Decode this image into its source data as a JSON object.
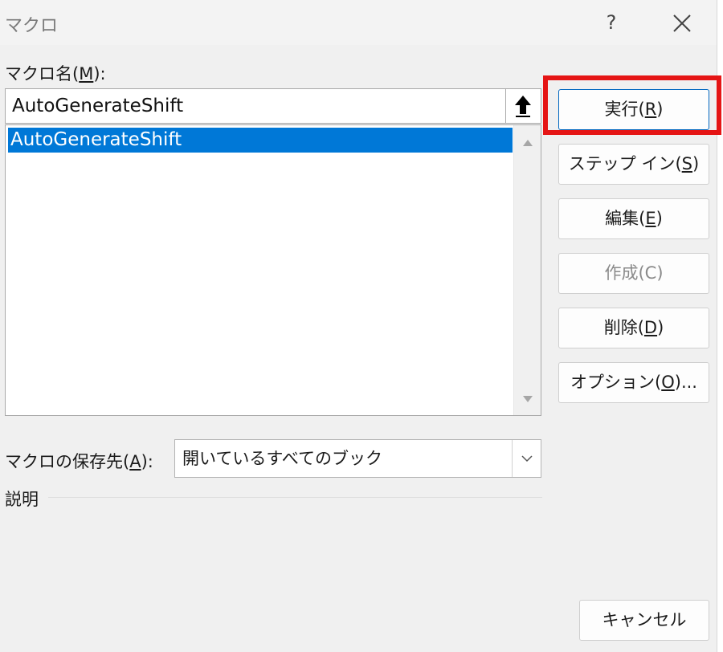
{
  "window": {
    "title": "マクロ",
    "help_label": "?",
    "close_icon": "close-icon"
  },
  "macro_name": {
    "label_prefix": "マクロ名(",
    "label_key": "M",
    "label_suffix": "):",
    "value": "AutoGenerateShift"
  },
  "macro_list": {
    "items": [
      "AutoGenerateShift"
    ],
    "selected_index": 0
  },
  "buttons": {
    "run": {
      "prefix": "実行(",
      "key": "R",
      "suffix": ")"
    },
    "step_in": {
      "prefix": "ステップ イン(",
      "key": "S",
      "suffix": ")"
    },
    "edit": {
      "prefix": "編集(",
      "key": "E",
      "suffix": ")"
    },
    "create": {
      "label": "作成(C)"
    },
    "delete": {
      "prefix": "削除(",
      "key": "D",
      "suffix": ")"
    },
    "options": {
      "prefix": "オプション(",
      "key": "O",
      "suffix": ")..."
    },
    "cancel": "キャンセル"
  },
  "macros_in": {
    "label_prefix": "マクロの保存先(",
    "label_key": "A",
    "label_suffix": "):",
    "selected": "開いているすべてのブック"
  },
  "description": {
    "label": "説明"
  },
  "colors": {
    "selection": "#0078d7",
    "highlight_box": "#e51515",
    "dialog_bg": "#f0f0f0"
  }
}
